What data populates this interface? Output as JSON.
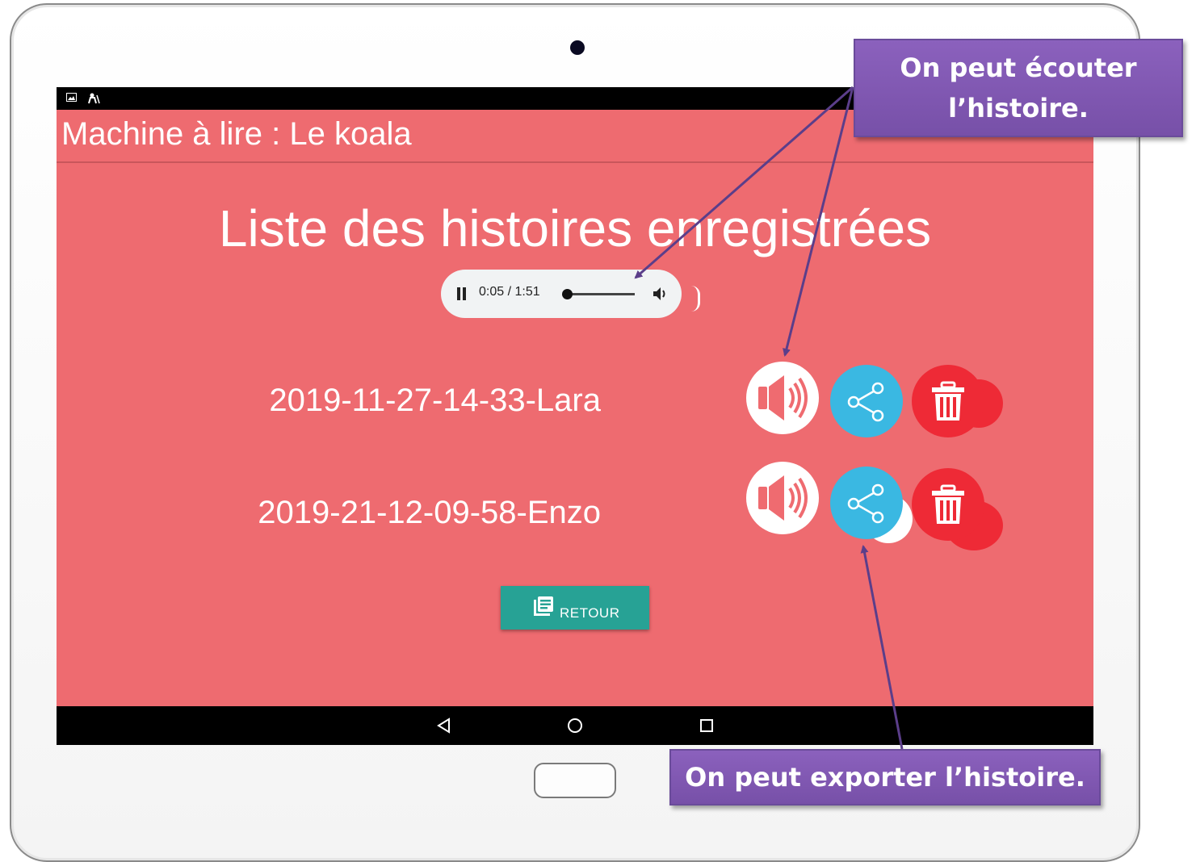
{
  "app": {
    "title": "Machine à lire : Le koala"
  },
  "page": {
    "heading": "Liste des histoires enregistrées"
  },
  "audio_player": {
    "time": "0:05 / 1:51",
    "progress": 0.045,
    "state": "playing",
    "icons": [
      "pause-icon",
      "volume-icon"
    ]
  },
  "stories": [
    {
      "name": "2019-11-27-14-33-Lara"
    },
    {
      "name": "2019-21-12-09-58-Enzo"
    }
  ],
  "row_actions": {
    "icons": [
      "speaker-icon",
      "share-icon",
      "trash-icon"
    ]
  },
  "retour_button": {
    "label": "RETOUR",
    "icon": "list-icon"
  },
  "nav_bar": {
    "icons": [
      "back-icon",
      "home-icon",
      "recents-icon"
    ]
  },
  "callouts": {
    "listen_line1": "On peut écouter",
    "listen_line2": "l’histoire.",
    "export": "On peut exporter l’histoire."
  },
  "colors": {
    "screen_background": "#ee6b70",
    "share_button": "#3ab8e2",
    "delete_button": "#ee2a36",
    "retour_button": "#27a295",
    "callout": "#7f57b0"
  }
}
